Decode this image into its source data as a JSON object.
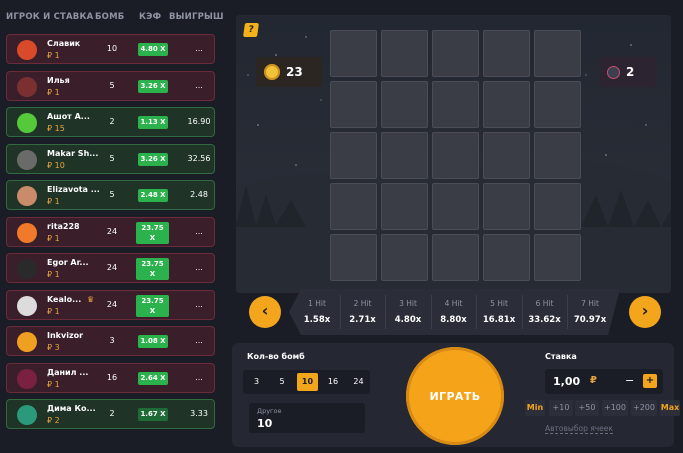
{
  "table": {
    "headers": {
      "player": "ИГРОК И СТАВКА",
      "bombs": "БОМБ",
      "coef": "КЭФ",
      "win": "ВЫИГРЫШ"
    },
    "rows": [
      {
        "name": "Славик",
        "bet": "₽ 1",
        "bombs": "10",
        "coef": "4.80 X",
        "win": "...",
        "result": "lose",
        "avatar_color": "#d84a2a"
      },
      {
        "name": "Илья",
        "bet": "₽ 1",
        "bombs": "5",
        "coef": "3.26 X",
        "win": "...",
        "result": "lose",
        "avatar_color": "#7a3030"
      },
      {
        "name": "Ашот А...",
        "bet": "₽ 15",
        "bombs": "2",
        "coef": "1.13 X",
        "win": "16.90",
        "result": "win",
        "avatar_color": "#54c93a"
      },
      {
        "name": "Makar Sh...",
        "bet": "₽ 10",
        "bombs": "5",
        "coef": "3.26 X",
        "win": "32.56",
        "result": "win",
        "avatar_color": "#6a6a6a"
      },
      {
        "name": "Elizavota ...",
        "bet": "₽ 1",
        "bombs": "5",
        "coef": "2.48 X",
        "win": "2.48",
        "result": "win",
        "avatar_color": "#c98b6a"
      },
      {
        "name": "rita228",
        "bet": "₽ 1",
        "bombs": "24",
        "coef": "23.75 X",
        "win": "...",
        "result": "lose",
        "avatar_color": "#f07a2a"
      },
      {
        "name": "Egor Ar...",
        "bet": "₽ 1",
        "bombs": "24",
        "coef": "23.75 X",
        "win": "...",
        "result": "lose",
        "avatar_color": "#2a2a2a"
      },
      {
        "name": "Kealo...",
        "bet": "₽ 1",
        "bombs": "24",
        "coef": "23.75 X",
        "win": "...",
        "result": "lose",
        "avatar_color": "#dcdcdc"
      },
      {
        "name": "Inkvizor",
        "bet": "₽ 3",
        "bombs": "3",
        "coef": "1.08 X",
        "win": "...",
        "result": "lose",
        "avatar_color": "#f0a020"
      },
      {
        "name": "Данил ...",
        "bet": "₽ 1",
        "bombs": "16",
        "coef": "2.64 X",
        "win": "...",
        "result": "lose",
        "avatar_color": "#7a2040"
      },
      {
        "name": "Дима Ко...",
        "bet": "₽ 2",
        "bombs": "2",
        "coef": "1.67 X",
        "win": "3.33",
        "result": "win",
        "avatar_color": "#2a9a7a"
      }
    ]
  },
  "game": {
    "help": "?",
    "gems_count": "23",
    "bombs_count": "2"
  },
  "multipliers": [
    {
      "hit": "1 Hit",
      "value": "1.58x"
    },
    {
      "hit": "2 Hit",
      "value": "2.71x"
    },
    {
      "hit": "3 Hit",
      "value": "4.80x"
    },
    {
      "hit": "4 Hit",
      "value": "8.80x"
    },
    {
      "hit": "5 Hit",
      "value": "16.81x"
    },
    {
      "hit": "6 Hit",
      "value": "33.62x"
    },
    {
      "hit": "7 Hit",
      "value": "70.97x"
    }
  ],
  "nav": {
    "prev": "‹",
    "next": "›"
  },
  "controls": {
    "bomb_count_label": "Кол-во бомб",
    "bomb_options": [
      "3",
      "5",
      "10",
      "16",
      "24"
    ],
    "selected_bomb": "10",
    "other_label": "Другое",
    "other_value": "10",
    "play_label": "ИГРАТЬ",
    "bet_label": "Ставка",
    "bet_value": "1,00",
    "currency": "₽",
    "minus": "−",
    "plus": "+",
    "chips": [
      "Min",
      "+10",
      "+50",
      "+100",
      "+200",
      "Max"
    ],
    "auto_select": "Автовыбор ячеек"
  },
  "colors": {
    "accent": "#f3a51b",
    "win": "#2bb24c",
    "lose_row": "#3a1f2a",
    "win_row": "#1f3326"
  }
}
